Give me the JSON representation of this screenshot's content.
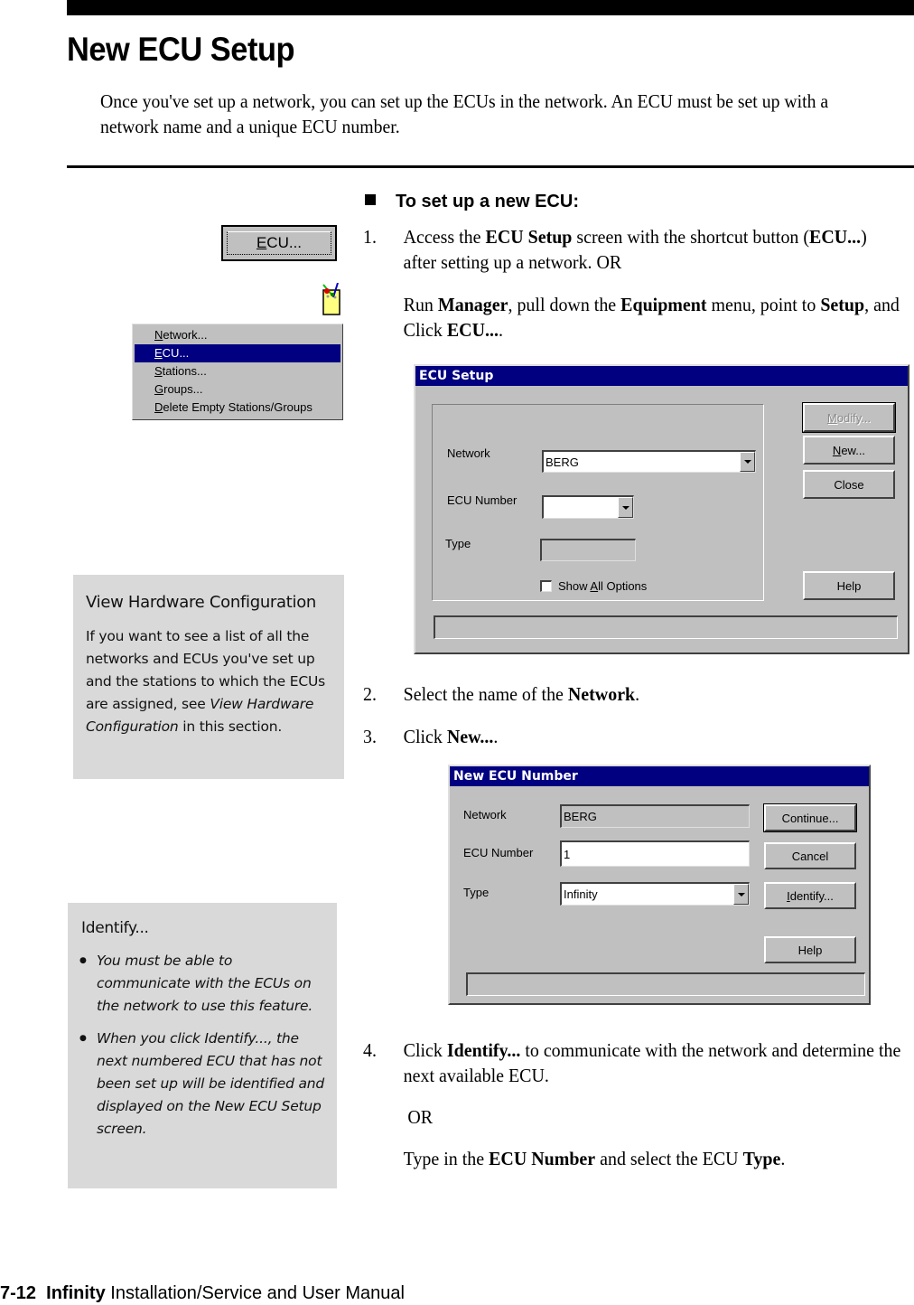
{
  "header": {
    "title": "New ECU Setup",
    "intro": "Once you've set up a network, you can set up the ECUs in the network. An ECU must be set up with a network name and a unique ECU number."
  },
  "sidebar": {
    "shortcut_button": {
      "label_underlined": "E",
      "label_rest": "CU..."
    },
    "setup_icon": "setup-tools-icon",
    "menu": {
      "items": [
        {
          "underlined": "N",
          "rest": "etwork...",
          "active": false
        },
        {
          "underlined": "E",
          "rest": "CU...",
          "active": true
        },
        {
          "underlined": "S",
          "rest": "tations...",
          "active": false
        },
        {
          "underlined": "G",
          "rest": "roups...",
          "active": false
        },
        {
          "underlined": "D",
          "rest": "elete Empty Stations/Groups",
          "active": false
        }
      ]
    },
    "note_hardware": {
      "heading": "View Hardware Configuration",
      "body_pre": "If you want to see a list of all the networks and ECUs you've set up and the stations to which the ECUs are assigned, see ",
      "body_italic": "View Hardware Configuration",
      "body_post": " in this section."
    },
    "note_identify": {
      "heading": "Identify...",
      "bullets": [
        "You must be able to communicate with the ECUs on the network to use this feature.",
        "When you click Identify..., the next numbered ECU that has not been set up will be identified and displayed on the New ECU Setup screen."
      ]
    }
  },
  "procedure": {
    "heading": "To set up a new ECU:",
    "step1": {
      "num": "1.",
      "a1": "Access the ",
      "b1": "ECU Setup",
      "a2": " screen with the shortcut button (",
      "b2": "ECU...",
      "a3": ") after setting up a network.  OR",
      "c1": "Run ",
      "d1": "Manager",
      "c2": ", pull down the ",
      "d2": "Equipment",
      "c3": " menu, point to ",
      "d3": "Setup",
      "c4": ", and Click ",
      "d4": "ECU...",
      "c5": "."
    },
    "step2": {
      "num": "2.",
      "a1": "Select the name of the ",
      "b1": "Network",
      "a2": "."
    },
    "step3": {
      "num": "3.",
      "a1": "Click ",
      "b1": "New...",
      "a2": "."
    },
    "step4": {
      "num": "4.",
      "a1": "Click ",
      "b1": "Identify...",
      "a2": " to communicate with the network and determine the next available ECU.",
      "or": "OR",
      "c1": "Type in the ",
      "d1": "ECU Number",
      "c2": " and  select the ECU ",
      "d2": "Type",
      "c3": "."
    }
  },
  "ecu_setup_dialog": {
    "title": "ECU Setup",
    "network_label": "Network",
    "network_value": "BERG",
    "ecu_number_label": "ECU Number",
    "ecu_number_value": "",
    "type_label": "Type",
    "type_value": "",
    "show_all_label_pre": "Show ",
    "show_all_label_u": "A",
    "show_all_label_post": "ll Options",
    "show_all_checked": false,
    "buttons": {
      "modify_u": "M",
      "modify_rest": "odify...",
      "new_u": "N",
      "new_rest": "ew...",
      "close": "Close",
      "help": "Help"
    },
    "status": ""
  },
  "new_ecu_dialog": {
    "title": "New ECU Number",
    "network_label": "Network",
    "network_value": "BERG",
    "ecu_number_label": "ECU Number",
    "ecu_number_value": "1",
    "type_label": "Type",
    "type_value": "Infinity",
    "buttons": {
      "continue": "Continue...",
      "cancel": "Cancel",
      "identify_u": "I",
      "identify_rest": "dentify...",
      "help": "Help"
    },
    "status": ""
  },
  "footer": {
    "page": "7-12",
    "product": "Infinity",
    "manual": "Installation/Service and User Manual"
  }
}
